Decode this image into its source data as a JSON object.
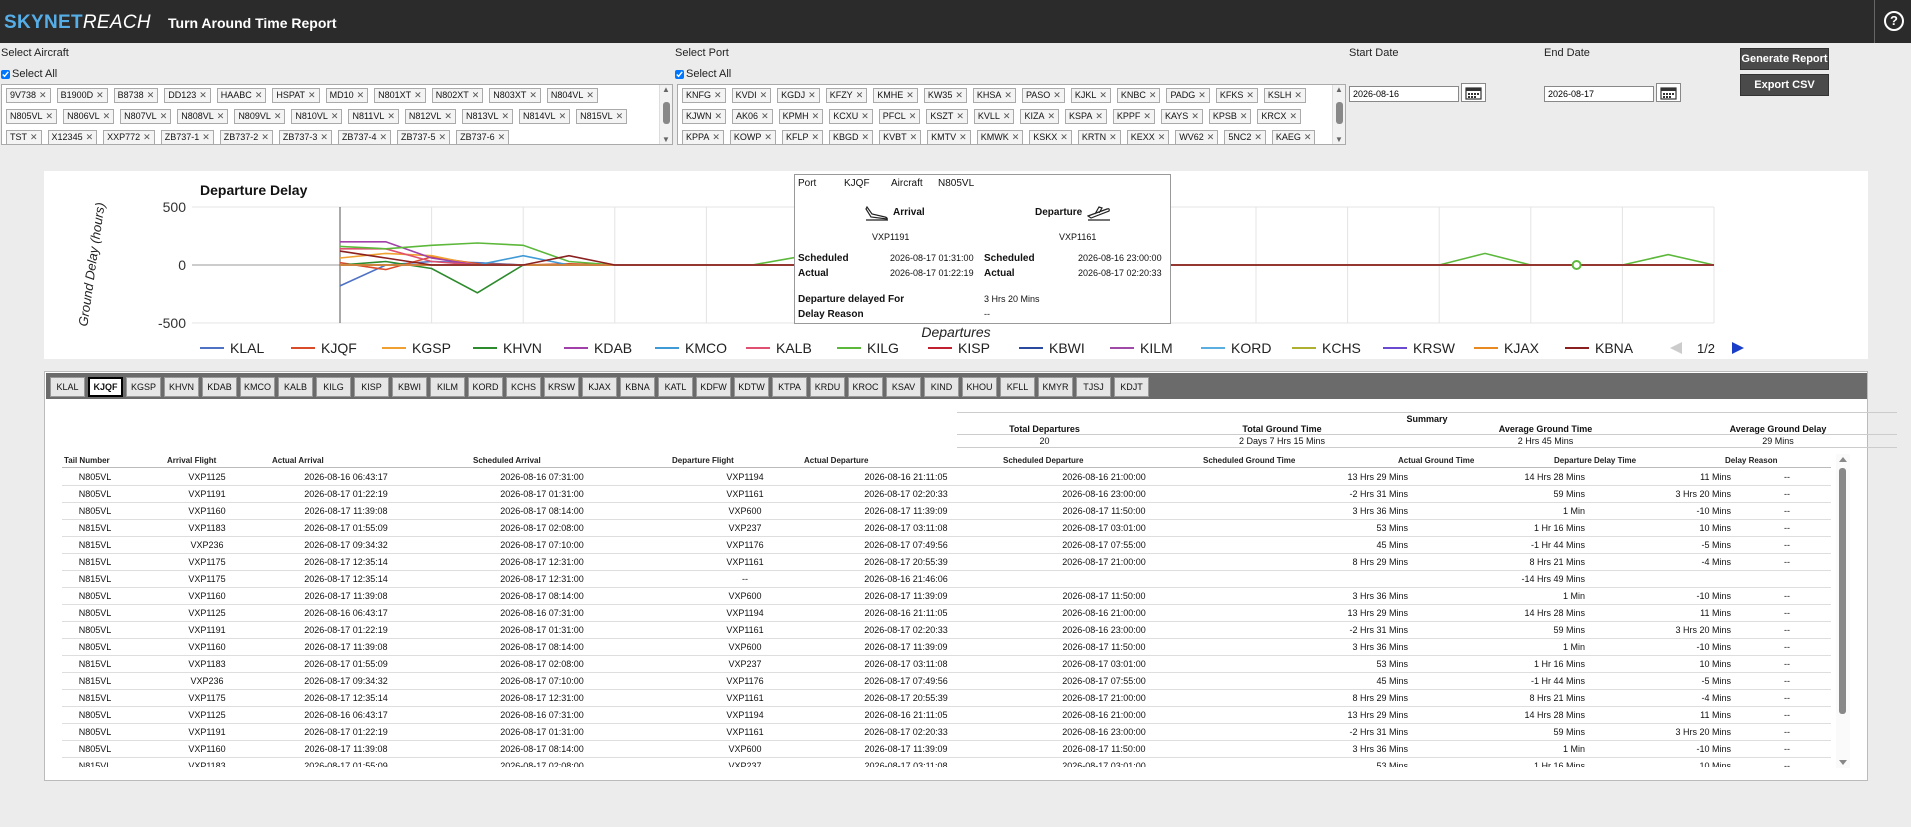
{
  "header": {
    "logo_part1": "SKYNET",
    "logo_part2": "REACH",
    "title": "Turn Around Time Report",
    "help_icon": "?"
  },
  "filters": {
    "aircraft_label": "Select Aircraft",
    "aircraft_select_all": "Select All",
    "aircraft_tags": [
      "9V738",
      "B1900D",
      "B8738",
      "DD123",
      "HAABC",
      "HSPAT",
      "MD10",
      "N801XT",
      "N802XT",
      "N803XT",
      "N804VL",
      "N805VL",
      "N806VL",
      "N807VL",
      "N808VL",
      "N809VL",
      "N810VL",
      "N811VL",
      "N812VL",
      "N813VL",
      "N814VL",
      "N815VL",
      "TST",
      "X12345",
      "XXP772",
      "ZB737-1",
      "ZB737-2",
      "ZB737-3",
      "ZB737-4",
      "ZB737-5",
      "ZB737-6"
    ],
    "port_label": "Select Port",
    "port_select_all": "Select All",
    "port_tags": [
      "KNFG",
      "KVDI",
      "KGDJ",
      "KFZY",
      "KMHE",
      "KW35",
      "KHSA",
      "PASO",
      "KJKL",
      "KNBC",
      "PADG",
      "KFKS",
      "KSLH",
      "KJWN",
      "AK06",
      "KPMH",
      "KCXU",
      "PFCL",
      "KSZT",
      "KVLL",
      "KIZA",
      "KSPA",
      "KPPF",
      "KAYS",
      "KPSB",
      "KRCX",
      "KPPA",
      "KOWP",
      "KFLP",
      "KBGD",
      "KVBT",
      "KMTV",
      "KMWK",
      "KSKX",
      "KRTN",
      "KEXX",
      "WV62",
      "5NC2",
      "KAEG"
    ],
    "start_label": "Start Date",
    "start_value": "2026-08-16",
    "end_label": "End Date",
    "end_value": "2026-08-17",
    "generate_button": "Generate Report",
    "export_button": "Export CSV"
  },
  "chart_data": {
    "type": "line",
    "title": "Departure Delay",
    "xlabel": "Departures",
    "ylabel": "Ground Delay (hours)",
    "ylim": [
      -500,
      500
    ],
    "yticks": [
      "500",
      "0",
      "-500"
    ],
    "legend_position": "bottom",
    "legend_page": "1/2",
    "series": [
      {
        "name": "KLAL",
        "color": "#4f72c4",
        "values": [
          -180,
          0,
          30,
          20,
          0,
          0,
          0,
          0,
          0,
          0,
          0,
          0,
          0,
          0,
          0,
          0,
          0,
          0,
          0,
          0,
          0,
          0,
          0,
          0,
          0,
          0,
          0,
          0,
          0,
          0,
          0
        ]
      },
      {
        "name": "KJQF",
        "color": "#d94c2a",
        "values": [
          20,
          -40,
          70,
          10,
          0,
          10,
          0,
          0,
          0,
          0,
          0,
          0,
          0,
          0,
          0,
          200,
          0,
          0,
          0,
          0,
          0,
          0,
          0,
          0,
          0,
          0,
          0,
          0,
          0,
          0,
          0
        ]
      },
      {
        "name": "KGSP",
        "color": "#f0a030",
        "values": [
          60,
          100,
          80,
          0,
          0,
          0,
          0,
          0,
          0,
          0,
          0,
          0,
          0,
          0,
          0,
          0,
          0,
          0,
          0,
          0,
          0,
          0,
          0,
          0,
          0,
          0,
          0,
          0,
          0,
          0,
          0
        ]
      },
      {
        "name": "KHVN",
        "color": "#2d8a2d",
        "values": [
          0,
          30,
          -30,
          -240,
          0,
          0,
          0,
          0,
          0,
          0,
          0,
          0,
          0,
          0,
          0,
          0,
          0,
          0,
          0,
          0,
          0,
          0,
          0,
          0,
          0,
          0,
          0,
          0,
          0,
          0,
          0
        ]
      },
      {
        "name": "KDAB",
        "color": "#a040a8",
        "values": [
          200,
          200,
          60,
          0,
          0,
          0,
          0,
          0,
          0,
          0,
          0,
          0,
          0,
          0,
          0,
          0,
          0,
          0,
          0,
          0,
          0,
          0,
          0,
          0,
          0,
          0,
          0,
          0,
          0,
          0,
          0
        ]
      },
      {
        "name": "KMCO",
        "color": "#3f9ad6",
        "values": [
          0,
          0,
          0,
          0,
          80,
          0,
          0,
          0,
          0,
          0,
          0,
          0,
          0,
          0,
          0,
          0,
          0,
          0,
          0,
          0,
          0,
          0,
          0,
          0,
          0,
          0,
          0,
          0,
          0,
          0,
          0
        ]
      },
      {
        "name": "KALB",
        "color": "#e05070",
        "values": [
          140,
          140,
          30,
          0,
          0,
          0,
          0,
          0,
          0,
          0,
          0,
          0,
          0,
          0,
          0,
          0,
          0,
          0,
          0,
          0,
          0,
          0,
          0,
          0,
          0,
          0,
          0,
          0,
          0,
          0,
          0
        ]
      },
      {
        "name": "KILG",
        "color": "#5cb83a",
        "values": [
          160,
          140,
          170,
          190,
          170,
          30,
          0,
          0,
          0,
          0,
          70,
          0,
          0,
          0,
          0,
          0,
          20,
          0,
          0,
          0,
          0,
          0,
          0,
          0,
          0,
          100,
          0,
          0,
          0,
          90,
          0
        ]
      },
      {
        "name": "KISP",
        "color": "#c02030",
        "values": [
          0,
          0,
          0,
          0,
          0,
          0,
          0,
          0,
          0,
          0,
          0,
          0,
          0,
          0,
          0,
          0,
          0,
          0,
          0,
          0,
          0,
          0,
          0,
          0,
          0,
          0,
          0,
          0,
          0,
          0,
          0
        ]
      },
      {
        "name": "KBWI",
        "color": "#2a4aa0",
        "values": [
          0,
          0,
          0,
          0,
          0,
          0,
          0,
          0,
          0,
          0,
          0,
          0,
          0,
          0,
          0,
          0,
          0,
          0,
          0,
          0,
          0,
          0,
          0,
          0,
          0,
          0,
          0,
          0,
          0,
          0,
          0
        ]
      },
      {
        "name": "KILM",
        "color": "#a04aa8",
        "values": [
          0,
          0,
          0,
          0,
          0,
          0,
          0,
          0,
          0,
          0,
          0,
          0,
          0,
          0,
          0,
          0,
          0,
          0,
          0,
          0,
          0,
          0,
          0,
          0,
          0,
          0,
          0,
          0,
          0,
          0,
          0
        ]
      },
      {
        "name": "KORD",
        "color": "#5aaee0",
        "values": [
          0,
          0,
          0,
          0,
          0,
          0,
          0,
          0,
          0,
          0,
          0,
          0,
          0,
          0,
          0,
          0,
          0,
          0,
          0,
          0,
          0,
          0,
          0,
          0,
          0,
          0,
          0,
          0,
          0,
          0,
          0
        ]
      },
      {
        "name": "KCHS",
        "color": "#b0b030",
        "values": [
          0,
          0,
          0,
          0,
          0,
          0,
          0,
          0,
          0,
          0,
          0,
          0,
          0,
          0,
          0,
          0,
          0,
          0,
          0,
          0,
          0,
          0,
          0,
          0,
          0,
          0,
          0,
          0,
          0,
          0,
          0
        ]
      },
      {
        "name": "KRSW",
        "color": "#6a4ad0",
        "values": [
          0,
          0,
          0,
          0,
          0,
          0,
          0,
          0,
          0,
          0,
          0,
          0,
          0,
          0,
          0,
          0,
          0,
          0,
          0,
          0,
          0,
          0,
          0,
          0,
          0,
          0,
          0,
          0,
          0,
          0,
          0
        ]
      },
      {
        "name": "KJAX",
        "color": "#e88a20",
        "values": [
          0,
          0,
          0,
          0,
          0,
          0,
          0,
          0,
          0,
          0,
          0,
          0,
          0,
          0,
          0,
          0,
          0,
          0,
          0,
          0,
          0,
          0,
          0,
          0,
          0,
          0,
          0,
          0,
          0,
          0,
          0
        ]
      },
      {
        "name": "KBNA",
        "color": "#8a2020",
        "values": [
          120,
          60,
          0,
          0,
          0,
          80,
          0,
          0,
          0,
          0,
          0,
          0,
          0,
          0,
          0,
          0,
          0,
          0,
          0,
          0,
          0,
          0,
          0,
          0,
          0,
          0,
          0,
          0,
          0,
          0,
          0
        ]
      }
    ]
  },
  "tooltip": {
    "port_label": "Port",
    "port_value": "KJQF",
    "aircraft_label": "Aircraft",
    "aircraft_value": "N805VL",
    "arrival_label": "Arrival",
    "departure_label": "Departure",
    "arrival_flight": "VXP1191",
    "departure_flight": "VXP1161",
    "scheduled_label": "Scheduled",
    "actual_label": "Actual",
    "arr_scheduled": "2026-08-17 01:31:00",
    "arr_actual": "2026-08-17 01:22:19",
    "dep_scheduled": "2026-08-16 23:00:00",
    "dep_actual": "2026-08-17 02:20:33",
    "delayed_label": "Departure delayed For",
    "delayed_value": "3 Hrs 20 Mins",
    "reason_label": "Delay Reason",
    "reason_value": "--"
  },
  "tabs": [
    "KLAL",
    "KJQF",
    "KGSP",
    "KHVN",
    "KDAB",
    "KMCO",
    "KALB",
    "KILG",
    "KISP",
    "KBWI",
    "KILM",
    "KORD",
    "KCHS",
    "KRSW",
    "KJAX",
    "KBNA",
    "KATL",
    "KDFW",
    "KDTW",
    "KTPA",
    "KRDU",
    "KROC",
    "KSAV",
    "KIND",
    "KHOU",
    "KFLL",
    "KMYR",
    "TJSJ",
    "KDJT"
  ],
  "active_tab": "KJQF",
  "summary": {
    "title": "Summary",
    "headers": [
      "Total Departures",
      "Total Ground Time",
      "Average Ground Time",
      "Average Ground Delay"
    ],
    "values": [
      "20",
      "2 Days 7 Hrs 15 Mins",
      "2 Hrs 45 Mins",
      "29 Mins"
    ]
  },
  "table": {
    "headers": [
      "Tail Number",
      "Arrival Flight",
      "Actual Arrival",
      "Scheduled Arrival",
      "Departure Flight",
      "Actual Departure",
      "Scheduled Departure",
      "Scheduled Ground Time",
      "Actual Ground Time",
      "Departure Delay Time",
      "Delay Reason"
    ],
    "rows": [
      [
        "N805VL",
        "VXP1125",
        "2026-08-16 06:43:17",
        "2026-08-16 07:31:00",
        "VXP1194",
        "2026-08-16 21:11:05",
        "2026-08-16 21:00:00",
        "13 Hrs 29 Mins",
        "14 Hrs 28 Mins",
        "11 Mins",
        "--"
      ],
      [
        "N805VL",
        "VXP1191",
        "2026-08-17 01:22:19",
        "2026-08-17 01:31:00",
        "VXP1161",
        "2026-08-17 02:20:33",
        "2026-08-16 23:00:00",
        "-2 Hrs 31 Mins",
        "59 Mins",
        "3 Hrs 20 Mins",
        "--"
      ],
      [
        "N805VL",
        "VXP1160",
        "2026-08-17 11:39:08",
        "2026-08-17 08:14:00",
        "VXP600",
        "2026-08-17 11:39:09",
        "2026-08-17 11:50:00",
        "3 Hrs 36 Mins",
        "1 Min",
        "-10 Mins",
        "--"
      ],
      [
        "N815VL",
        "VXP1183",
        "2026-08-17 01:55:09",
        "2026-08-17 02:08:00",
        "VXP237",
        "2026-08-17 03:11:08",
        "2026-08-17 03:01:00",
        "53 Mins",
        "1 Hr 16 Mins",
        "10 Mins",
        "--"
      ],
      [
        "N815VL",
        "VXP236",
        "2026-08-17 09:34:32",
        "2026-08-17 07:10:00",
        "VXP1176",
        "2026-08-17 07:49:56",
        "2026-08-17 07:55:00",
        "45 Mins",
        "-1 Hr 44 Mins",
        "-5 Mins",
        "--"
      ],
      [
        "N815VL",
        "VXP1175",
        "2026-08-17 12:35:14",
        "2026-08-17 12:31:00",
        "VXP1161",
        "2026-08-17 20:55:39",
        "2026-08-17 21:00:00",
        "8 Hrs 29 Mins",
        "8 Hrs 21 Mins",
        "-4 Mins",
        "--"
      ],
      [
        "N815VL",
        "VXP1175",
        "2026-08-17 12:35:14",
        "2026-08-17 12:31:00",
        "--",
        "2026-08-16 21:46:06",
        "",
        "",
        "-14 Hrs 49 Mins",
        "",
        ""
      ],
      [
        "N805VL",
        "VXP1160",
        "2026-08-17 11:39:08",
        "2026-08-17 08:14:00",
        "VXP600",
        "2026-08-17 11:39:09",
        "2026-08-17 11:50:00",
        "3 Hrs 36 Mins",
        "1 Min",
        "-10 Mins",
        "--"
      ],
      [
        "N805VL",
        "VXP1125",
        "2026-08-16 06:43:17",
        "2026-08-16 07:31:00",
        "VXP1194",
        "2026-08-16 21:11:05",
        "2026-08-16 21:00:00",
        "13 Hrs 29 Mins",
        "14 Hrs 28 Mins",
        "11 Mins",
        "--"
      ],
      [
        "N805VL",
        "VXP1191",
        "2026-08-17 01:22:19",
        "2026-08-17 01:31:00",
        "VXP1161",
        "2026-08-17 02:20:33",
        "2026-08-16 23:00:00",
        "-2 Hrs 31 Mins",
        "59 Mins",
        "3 Hrs 20 Mins",
        "--"
      ],
      [
        "N805VL",
        "VXP1160",
        "2026-08-17 11:39:08",
        "2026-08-17 08:14:00",
        "VXP600",
        "2026-08-17 11:39:09",
        "2026-08-17 11:50:00",
        "3 Hrs 36 Mins",
        "1 Min",
        "-10 Mins",
        "--"
      ],
      [
        "N815VL",
        "VXP1183",
        "2026-08-17 01:55:09",
        "2026-08-17 02:08:00",
        "VXP237",
        "2026-08-17 03:11:08",
        "2026-08-17 03:01:00",
        "53 Mins",
        "1 Hr 16 Mins",
        "10 Mins",
        "--"
      ],
      [
        "N815VL",
        "VXP236",
        "2026-08-17 09:34:32",
        "2026-08-17 07:10:00",
        "VXP1176",
        "2026-08-17 07:49:56",
        "2026-08-17 07:55:00",
        "45 Mins",
        "-1 Hr 44 Mins",
        "-5 Mins",
        "--"
      ],
      [
        "N815VL",
        "VXP1175",
        "2026-08-17 12:35:14",
        "2026-08-17 12:31:00",
        "VXP1161",
        "2026-08-17 20:55:39",
        "2026-08-17 21:00:00",
        "8 Hrs 29 Mins",
        "8 Hrs 21 Mins",
        "-4 Mins",
        "--"
      ],
      [
        "N805VL",
        "VXP1125",
        "2026-08-16 06:43:17",
        "2026-08-16 07:31:00",
        "VXP1194",
        "2026-08-16 21:11:05",
        "2026-08-16 21:00:00",
        "13 Hrs 29 Mins",
        "14 Hrs 28 Mins",
        "11 Mins",
        "--"
      ],
      [
        "N805VL",
        "VXP1191",
        "2026-08-17 01:22:19",
        "2026-08-17 01:31:00",
        "VXP1161",
        "2026-08-17 02:20:33",
        "2026-08-16 23:00:00",
        "-2 Hrs 31 Mins",
        "59 Mins",
        "3 Hrs 20 Mins",
        "--"
      ],
      [
        "N805VL",
        "VXP1160",
        "2026-08-17 11:39:08",
        "2026-08-17 08:14:00",
        "VXP600",
        "2026-08-17 11:39:09",
        "2026-08-17 11:50:00",
        "3 Hrs 36 Mins",
        "1 Min",
        "-10 Mins",
        "--"
      ],
      [
        "N815VL",
        "VXP1183",
        "2026-08-17 01:55:09",
        "2026-08-17 02:08:00",
        "VXP237",
        "2026-08-17 03:11:08",
        "2026-08-17 03:01:00",
        "53 Mins",
        "1 Hr 16 Mins",
        "10 Mins",
        "--"
      ]
    ]
  }
}
